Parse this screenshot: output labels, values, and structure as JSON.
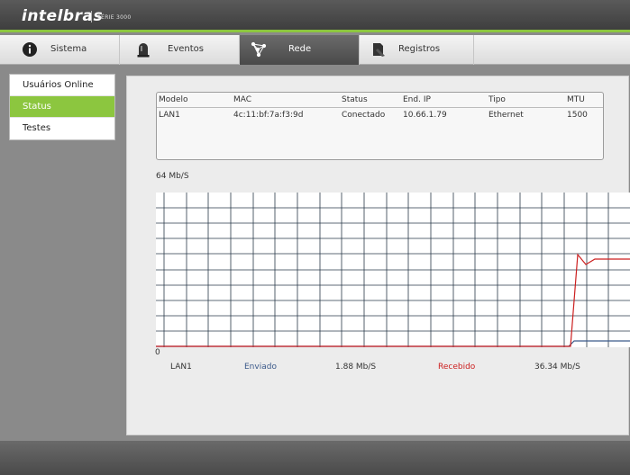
{
  "brand": {
    "name": "intelbras",
    "series": "SÉRIE 3000"
  },
  "nav": {
    "tabs": [
      {
        "label": "Sistema",
        "icon": "info-icon"
      },
      {
        "label": "Eventos",
        "icon": "siren-icon"
      },
      {
        "label": "Rede",
        "icon": "network-icon",
        "active": true
      },
      {
        "label": "Registros",
        "icon": "log-icon"
      }
    ]
  },
  "sidebar": {
    "items": [
      {
        "label": "Usuários Online"
      },
      {
        "label": "Status",
        "active": true
      },
      {
        "label": "Testes"
      }
    ]
  },
  "table": {
    "headers": [
      "Modelo",
      "MAC",
      "Status",
      "End. IP",
      "Tipo",
      "MTU"
    ],
    "rows": [
      [
        "LAN1",
        "4c:11:bf:7a:f3:9d",
        "Conectado",
        "10.66.1.79",
        "Ethernet",
        "1500"
      ]
    ]
  },
  "graph": {
    "max_label": "64 Mb/S",
    "min_label": "0",
    "colors": {
      "sent": "#3c5a8a",
      "received": "#cc1f1f"
    }
  },
  "legend": {
    "interface": "LAN1",
    "sent_label": "Enviado",
    "sent_value": "1.88 Mb/S",
    "received_label": "Recebido",
    "received_value": "36.34 Mb/S"
  },
  "colors": {
    "accent": "#8cc63f"
  }
}
